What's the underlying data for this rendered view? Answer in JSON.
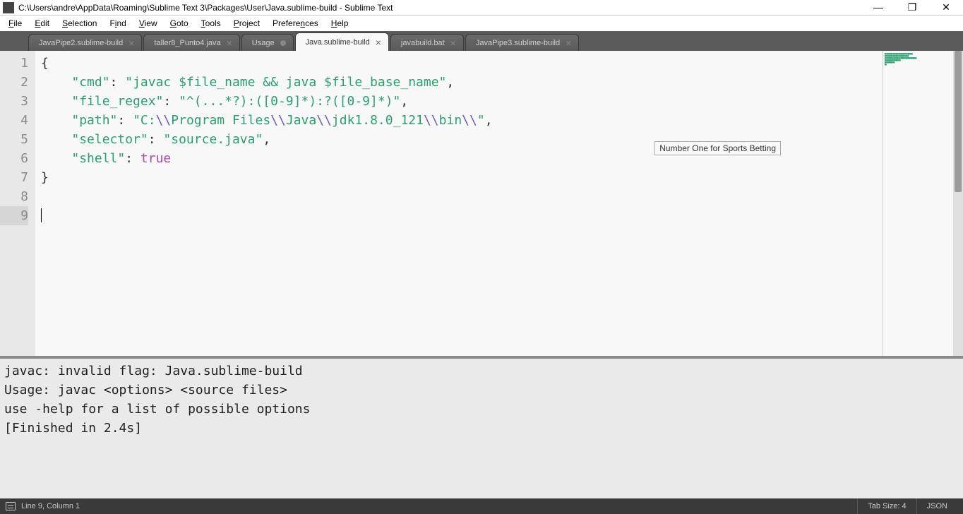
{
  "title": "C:\\Users\\andre\\AppData\\Roaming\\Sublime Text 3\\Packages\\User\\Java.sublime-build - Sublime Text",
  "menu": [
    "File",
    "Edit",
    "Selection",
    "Find",
    "View",
    "Goto",
    "Tools",
    "Project",
    "Preferences",
    "Help"
  ],
  "tabs": [
    {
      "label": "JavaPipe2.sublime-build",
      "close": "×",
      "dirty": false,
      "active": false
    },
    {
      "label": "taller8_Punto4.java",
      "close": "×",
      "dirty": false,
      "active": false
    },
    {
      "label": "Usage",
      "close": "",
      "dirty": true,
      "active": false
    },
    {
      "label": "Java.sublime-build",
      "close": "×",
      "dirty": false,
      "active": true
    },
    {
      "label": "javabuild.bat",
      "close": "×",
      "dirty": false,
      "active": false
    },
    {
      "label": "JavaPipe3.sublime-build",
      "close": "×",
      "dirty": false,
      "active": false
    }
  ],
  "gutter": [
    "1",
    "2",
    "3",
    "4",
    "5",
    "6",
    "7",
    "8",
    "9"
  ],
  "code": {
    "l1": "{",
    "l2": {
      "k": "\"cmd\"",
      "v": "\"javac $file_name && java $file_base_name\"",
      "c": ","
    },
    "l3": {
      "k": "\"file_regex\"",
      "v": "\"^(...*?):([0-9]*):?([0-9]*)\"",
      "c": ","
    },
    "l4": {
      "k": "\"path\"",
      "pre": "\"C:",
      "e1": "\\\\",
      "m1": "Program Files",
      "e2": "\\\\",
      "m2": "Java",
      "e3": "\\\\",
      "m3": "jdk1.8.0_121",
      "e4": "\\\\",
      "m4": "bin",
      "e5": "\\\\",
      "post": "\"",
      "c": ","
    },
    "l5": {
      "k": "\"selector\"",
      "v": "\"source.java\"",
      "c": ","
    },
    "l6": {
      "k": "\"shell\"",
      "kw": "true"
    },
    "l7": "}"
  },
  "tooltip": "Number One for Sports Betting",
  "console": {
    "l1": "javac: invalid flag: Java.sublime-build",
    "l2": "Usage: javac <options> <source files>",
    "l3": "use -help for a list of possible options",
    "l4": "[Finished in 2.4s]"
  },
  "status": {
    "pos": "Line 9, Column 1",
    "tabsize": "Tab Size: 4",
    "syntax": "JSON"
  },
  "win": {
    "min": "—",
    "max": "❐",
    "close": "✕"
  }
}
